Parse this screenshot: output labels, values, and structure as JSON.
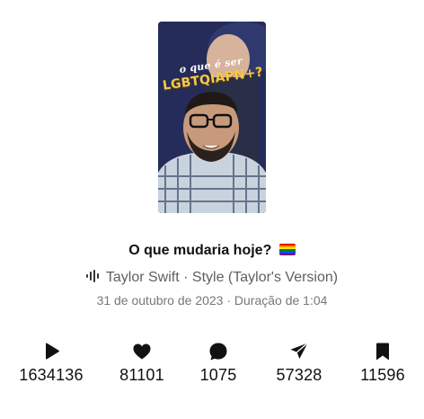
{
  "thumbnail": {
    "overlay_sub": "o que é ser",
    "overlay_main": "LGBTQIAPN+?"
  },
  "post": {
    "title": "O que mudaria hoje?",
    "title_emoji_icon": "rainbow-flag-icon",
    "music_icon": "sound-wave-icon",
    "music": "Taylor Swift · Style (Taylor's Version)",
    "meta": "31 de outubro de 2023 · Duração de 1:04"
  },
  "stats": [
    {
      "icon": "play-icon",
      "value": "1634136"
    },
    {
      "icon": "heart-icon",
      "value": "81101"
    },
    {
      "icon": "comment-icon",
      "value": "1075"
    },
    {
      "icon": "share-icon",
      "value": "57328"
    },
    {
      "icon": "bookmark-icon",
      "value": "11596"
    }
  ],
  "colors": {
    "text_primary": "#111111",
    "text_secondary": "#5f5f5f",
    "text_meta": "#777777",
    "overlay_yellow": "#f6c945"
  }
}
